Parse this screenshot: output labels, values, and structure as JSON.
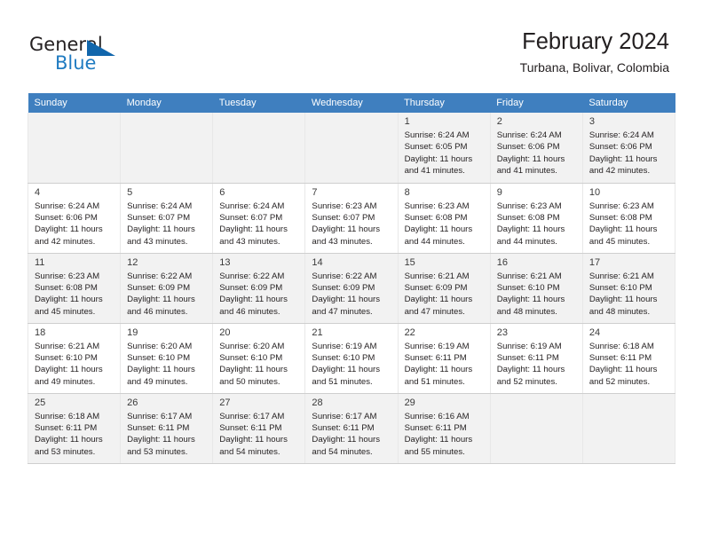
{
  "brand": {
    "name_part1": "General",
    "name_part2": "Blue",
    "triangle_color": "#1166ac",
    "blue_color": "#1f7bc1"
  },
  "header": {
    "month_title": "February 2024",
    "location": "Turbana, Bolivar, Colombia"
  },
  "theme": {
    "header_row_bg": "#3f7fbf",
    "alt_row_bg": "#f2f2f2",
    "text_color": "#231f20"
  },
  "calendar": {
    "weekday_headers": [
      "Sunday",
      "Monday",
      "Tuesday",
      "Wednesday",
      "Thursday",
      "Friday",
      "Saturday"
    ],
    "weeks": [
      [
        {
          "day": "",
          "info": ""
        },
        {
          "day": "",
          "info": ""
        },
        {
          "day": "",
          "info": ""
        },
        {
          "day": "",
          "info": ""
        },
        {
          "day": "1",
          "info": "Sunrise: 6:24 AM\nSunset: 6:05 PM\nDaylight: 11 hours\nand 41 minutes."
        },
        {
          "day": "2",
          "info": "Sunrise: 6:24 AM\nSunset: 6:06 PM\nDaylight: 11 hours\nand 41 minutes."
        },
        {
          "day": "3",
          "info": "Sunrise: 6:24 AM\nSunset: 6:06 PM\nDaylight: 11 hours\nand 42 minutes."
        }
      ],
      [
        {
          "day": "4",
          "info": "Sunrise: 6:24 AM\nSunset: 6:06 PM\nDaylight: 11 hours\nand 42 minutes."
        },
        {
          "day": "5",
          "info": "Sunrise: 6:24 AM\nSunset: 6:07 PM\nDaylight: 11 hours\nand 43 minutes."
        },
        {
          "day": "6",
          "info": "Sunrise: 6:24 AM\nSunset: 6:07 PM\nDaylight: 11 hours\nand 43 minutes."
        },
        {
          "day": "7",
          "info": "Sunrise: 6:23 AM\nSunset: 6:07 PM\nDaylight: 11 hours\nand 43 minutes."
        },
        {
          "day": "8",
          "info": "Sunrise: 6:23 AM\nSunset: 6:08 PM\nDaylight: 11 hours\nand 44 minutes."
        },
        {
          "day": "9",
          "info": "Sunrise: 6:23 AM\nSunset: 6:08 PM\nDaylight: 11 hours\nand 44 minutes."
        },
        {
          "day": "10",
          "info": "Sunrise: 6:23 AM\nSunset: 6:08 PM\nDaylight: 11 hours\nand 45 minutes."
        }
      ],
      [
        {
          "day": "11",
          "info": "Sunrise: 6:23 AM\nSunset: 6:08 PM\nDaylight: 11 hours\nand 45 minutes."
        },
        {
          "day": "12",
          "info": "Sunrise: 6:22 AM\nSunset: 6:09 PM\nDaylight: 11 hours\nand 46 minutes."
        },
        {
          "day": "13",
          "info": "Sunrise: 6:22 AM\nSunset: 6:09 PM\nDaylight: 11 hours\nand 46 minutes."
        },
        {
          "day": "14",
          "info": "Sunrise: 6:22 AM\nSunset: 6:09 PM\nDaylight: 11 hours\nand 47 minutes."
        },
        {
          "day": "15",
          "info": "Sunrise: 6:21 AM\nSunset: 6:09 PM\nDaylight: 11 hours\nand 47 minutes."
        },
        {
          "day": "16",
          "info": "Sunrise: 6:21 AM\nSunset: 6:10 PM\nDaylight: 11 hours\nand 48 minutes."
        },
        {
          "day": "17",
          "info": "Sunrise: 6:21 AM\nSunset: 6:10 PM\nDaylight: 11 hours\nand 48 minutes."
        }
      ],
      [
        {
          "day": "18",
          "info": "Sunrise: 6:21 AM\nSunset: 6:10 PM\nDaylight: 11 hours\nand 49 minutes."
        },
        {
          "day": "19",
          "info": "Sunrise: 6:20 AM\nSunset: 6:10 PM\nDaylight: 11 hours\nand 49 minutes."
        },
        {
          "day": "20",
          "info": "Sunrise: 6:20 AM\nSunset: 6:10 PM\nDaylight: 11 hours\nand 50 minutes."
        },
        {
          "day": "21",
          "info": "Sunrise: 6:19 AM\nSunset: 6:10 PM\nDaylight: 11 hours\nand 51 minutes."
        },
        {
          "day": "22",
          "info": "Sunrise: 6:19 AM\nSunset: 6:11 PM\nDaylight: 11 hours\nand 51 minutes."
        },
        {
          "day": "23",
          "info": "Sunrise: 6:19 AM\nSunset: 6:11 PM\nDaylight: 11 hours\nand 52 minutes."
        },
        {
          "day": "24",
          "info": "Sunrise: 6:18 AM\nSunset: 6:11 PM\nDaylight: 11 hours\nand 52 minutes."
        }
      ],
      [
        {
          "day": "25",
          "info": "Sunrise: 6:18 AM\nSunset: 6:11 PM\nDaylight: 11 hours\nand 53 minutes."
        },
        {
          "day": "26",
          "info": "Sunrise: 6:17 AM\nSunset: 6:11 PM\nDaylight: 11 hours\nand 53 minutes."
        },
        {
          "day": "27",
          "info": "Sunrise: 6:17 AM\nSunset: 6:11 PM\nDaylight: 11 hours\nand 54 minutes."
        },
        {
          "day": "28",
          "info": "Sunrise: 6:17 AM\nSunset: 6:11 PM\nDaylight: 11 hours\nand 54 minutes."
        },
        {
          "day": "29",
          "info": "Sunrise: 6:16 AM\nSunset: 6:11 PM\nDaylight: 11 hours\nand 55 minutes."
        },
        {
          "day": "",
          "info": ""
        },
        {
          "day": "",
          "info": ""
        }
      ]
    ]
  }
}
